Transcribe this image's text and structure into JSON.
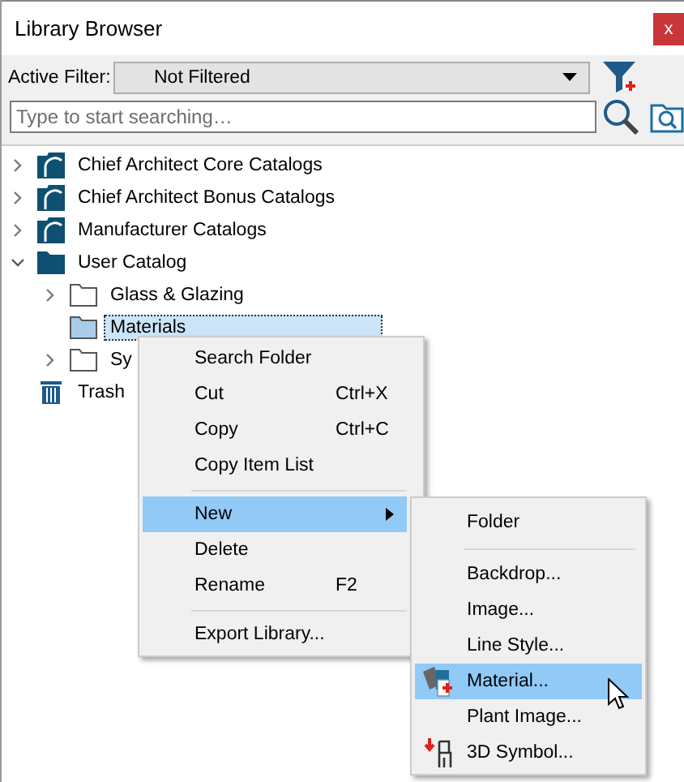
{
  "window": {
    "title": "Library Browser",
    "close": "x"
  },
  "filter": {
    "label": "Active Filter:",
    "value": "Not Filtered"
  },
  "search": {
    "placeholder": "Type to start searching…"
  },
  "tree": [
    {
      "label": "Chief Architect Core Catalogs",
      "kind": "catalog",
      "expanded": false,
      "selected": false
    },
    {
      "label": "Chief Architect Bonus Catalogs",
      "kind": "catalog",
      "expanded": false,
      "selected": false
    },
    {
      "label": "Manufacturer Catalogs",
      "kind": "catalog",
      "expanded": false,
      "selected": false
    },
    {
      "label": "User Catalog",
      "kind": "folder_filled",
      "expanded": true,
      "selected": false,
      "children": [
        {
          "label": "Glass & Glazing",
          "kind": "folder",
          "expanded": false,
          "selected": false
        },
        {
          "label": "Materials",
          "kind": "folder",
          "selected": true
        },
        {
          "label": "Sy",
          "kind": "folder",
          "expanded": false,
          "selected": false
        }
      ]
    },
    {
      "label": "Trash",
      "kind": "trash",
      "selected": false
    }
  ],
  "context_menu": [
    {
      "label": "Search Folder",
      "selected": false
    },
    {
      "label": "Cut",
      "shortcut": "Ctrl+X",
      "selected": false
    },
    {
      "label": "Copy",
      "shortcut": "Ctrl+C",
      "selected": false
    },
    {
      "label": "Copy Item List",
      "selected": false,
      "separator_after": true
    },
    {
      "label": "New",
      "selected": true,
      "submenu": true
    },
    {
      "label": "Delete",
      "selected": false
    },
    {
      "label": "Rename",
      "shortcut": "F2",
      "selected": false,
      "separator_after": true
    },
    {
      "label": "Export Library...",
      "selected": false
    }
  ],
  "submenu": [
    {
      "label": "Folder",
      "kind": "plain",
      "selected": false,
      "separator_after": true
    },
    {
      "label": "Backdrop...",
      "kind": "plain",
      "selected": false
    },
    {
      "label": "Image...",
      "kind": "plain",
      "selected": false
    },
    {
      "label": "Line Style...",
      "kind": "plain",
      "selected": false
    },
    {
      "label": "Material...",
      "kind": "material",
      "selected": true
    },
    {
      "label": "Plant Image...",
      "kind": "plain",
      "selected": false
    },
    {
      "label": "3D Symbol...",
      "kind": "symbol",
      "selected": false
    }
  ]
}
